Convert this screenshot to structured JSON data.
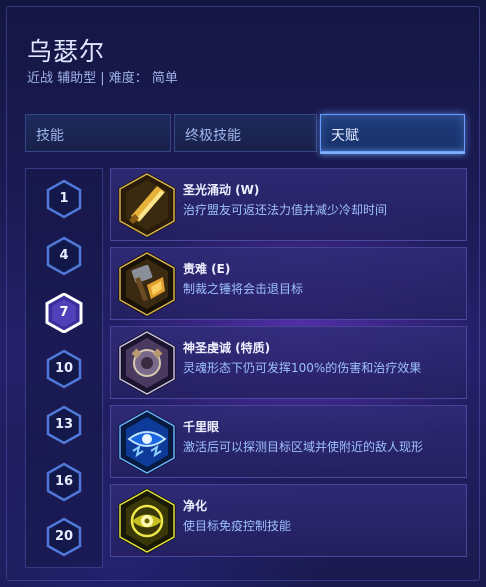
{
  "hero": {
    "name": "乌瑟尔",
    "subtitle": "近战 辅助型 | 难度： 简单"
  },
  "tabs": [
    {
      "label": "技能",
      "active": false
    },
    {
      "label": "终极技能",
      "active": false
    },
    {
      "label": "天赋",
      "active": true
    }
  ],
  "levels": [
    {
      "label": "1",
      "active": false
    },
    {
      "label": "4",
      "active": false
    },
    {
      "label": "7",
      "active": true
    },
    {
      "label": "10",
      "active": false
    },
    {
      "label": "13",
      "active": false
    },
    {
      "label": "16",
      "active": false
    },
    {
      "label": "20",
      "active": false
    }
  ],
  "talents": [
    {
      "name": "圣光涌动 (W)",
      "description": "治疗盟友可返还法力值并减少冷却时间",
      "icon": "holy-light-surge-icon"
    },
    {
      "name": "责难 (E)",
      "description": "制裁之锤将会击退目标",
      "icon": "hammer-of-justice-icon"
    },
    {
      "name": "神圣虔诚 (特质)",
      "description": "灵魂形态下仍可发挥100%的伤害和治疗效果",
      "icon": "divine-devotion-icon"
    },
    {
      "name": "千里眼",
      "description": "激活后可以探测目标区域并使附近的敌人现形",
      "icon": "clairvoyance-icon"
    },
    {
      "name": "净化",
      "description": "使目标免疫控制技能",
      "icon": "cleanse-icon"
    }
  ],
  "colors": {
    "accent": "#7db0ff",
    "talent_desc": "#9ec0ff",
    "gold_frame": "#d9b24a"
  }
}
